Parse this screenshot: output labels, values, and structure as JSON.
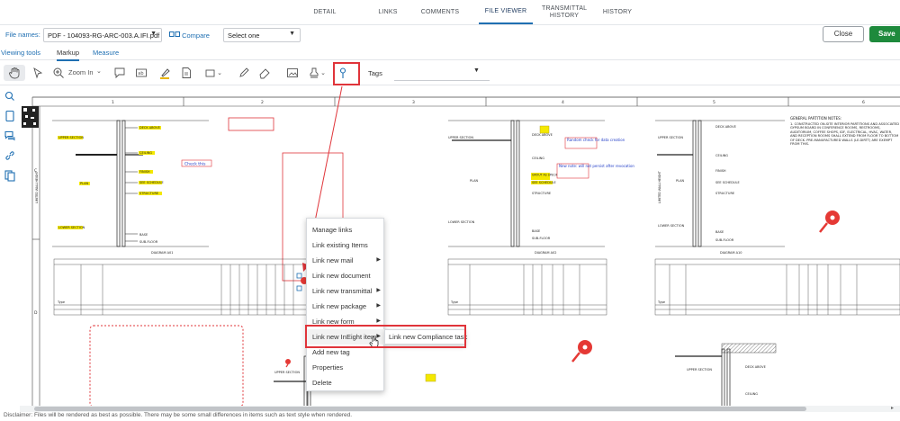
{
  "nav": {
    "tabs": [
      "DETAIL",
      "LINKS",
      "COMMENTS",
      "FILE VIEWER",
      "TRANSMITTAL HISTORY",
      "HISTORY"
    ],
    "active": "FILE VIEWER"
  },
  "filebar": {
    "label": "File names",
    "file_value": "PDF - 104093-RG-ARC-003.A.IFI.pdf",
    "compare_label": "Compare",
    "compare_select": "Select one",
    "close_label": "Close",
    "save_label": "Save"
  },
  "subtabs": {
    "viewing": "Viewing tools",
    "markup": "Markup",
    "measure": "Measure"
  },
  "toolbar": {
    "zoom_label": "Zoom In",
    "tags_label": "Tags"
  },
  "context_menu": {
    "manage_links": "Manage links",
    "link_existing": "Link existing Items",
    "link_mail": "Link new mail",
    "link_document": "Link new document",
    "link_transmittal": "Link new transmittal",
    "link_package": "Link new package",
    "link_form": "Link new form",
    "link_ineight": "Link new InEight item",
    "add_tag": "Add new tag",
    "properties": "Properties",
    "delete": "Delete"
  },
  "submenu": {
    "compliance": "Link new Compliance task"
  },
  "drawing": {
    "rulers": [
      "1",
      "2",
      "3",
      "4",
      "5",
      "6"
    ],
    "row_marks": [
      "C",
      "D"
    ],
    "labels": {
      "upper_section": "UPPER SECTION",
      "lower_section": "LOWER SECTION",
      "deck_above": "DECK ABOVE",
      "ceiling": "CEILING",
      "finish": "FINISH",
      "see_schedule": "SEE SCHEDULE",
      "structure": "STRUCTURE",
      "plan": "PLAN",
      "base": "BASE",
      "sub_floor": "SUB-FLOOR",
      "diagram_a01": "DIAGRAM A01",
      "diagram_a02": "DIAGRAM A02",
      "diagram_a10": "DIAGRAM A10",
      "grout": "GROUT AS SPECIFIED",
      "type": "Type"
    },
    "notes": {
      "check_this": "Check this",
      "random": "Random check for data creation",
      "new_note": "New note: will not persist after revocation"
    },
    "general_notes_title": "GENERAL PARTITION NOTES:",
    "general_notes_text": "1. CONSTRUCTED ON-SITE INTERIOR PARTITIONS AND ASSOCIATED GYPSUM BOARD IN CONFERENCE ROOMS, RESTROOMS, AUDITORIUM, COFFEE SHOPS, IDF, ELECTRICAL, HVAC, WATER, AND RECEPTION ROOMS SHALL EXTEND FROM FLOOR TO BOTTOM OF DECK. PRE-MANUFACTURED WALLS (LE.DIRTT) ARE EXEMPT FROM THIS."
  },
  "disclaimer": "Disclaimer: Files will be rendered as best as possible. There may be some small differences in items such as text style when rendered.",
  "colors": {
    "accent": "#1f6fb2",
    "save": "#1e8a3c",
    "annotation_red": "#e0343a",
    "pin_red": "#e53935"
  }
}
